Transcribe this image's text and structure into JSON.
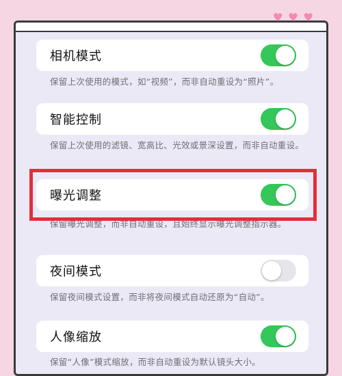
{
  "hearts": [
    "♥",
    "♥",
    "♥"
  ],
  "settings": [
    {
      "label": "相机模式",
      "on": true,
      "desc": "保留上次使用的模式，如“视频”，而非自动重设为“照片”。"
    },
    {
      "label": "智能控制",
      "on": true,
      "desc": "保留上次使用的滤镜、宽高比、光效或景深设置，而非自动重设。"
    },
    {
      "label": "曝光调整",
      "on": true,
      "desc": "保留曝光调整，而非自动重设，且始终显示曝光调整指示器。"
    },
    {
      "label": "夜间模式",
      "on": false,
      "desc": "保留夜间模式设置，而非将夜间模式自动还原为“自动”。"
    },
    {
      "label": "人像缩放",
      "on": true,
      "desc": "保留“人像”模式缩放，而非自动重设为默认镜头大小。"
    }
  ],
  "colors": {
    "toggle_on": "#34c759",
    "toggle_off": "#e6e6ea",
    "highlight": "#e0303a",
    "background": "#f7d6e3"
  }
}
